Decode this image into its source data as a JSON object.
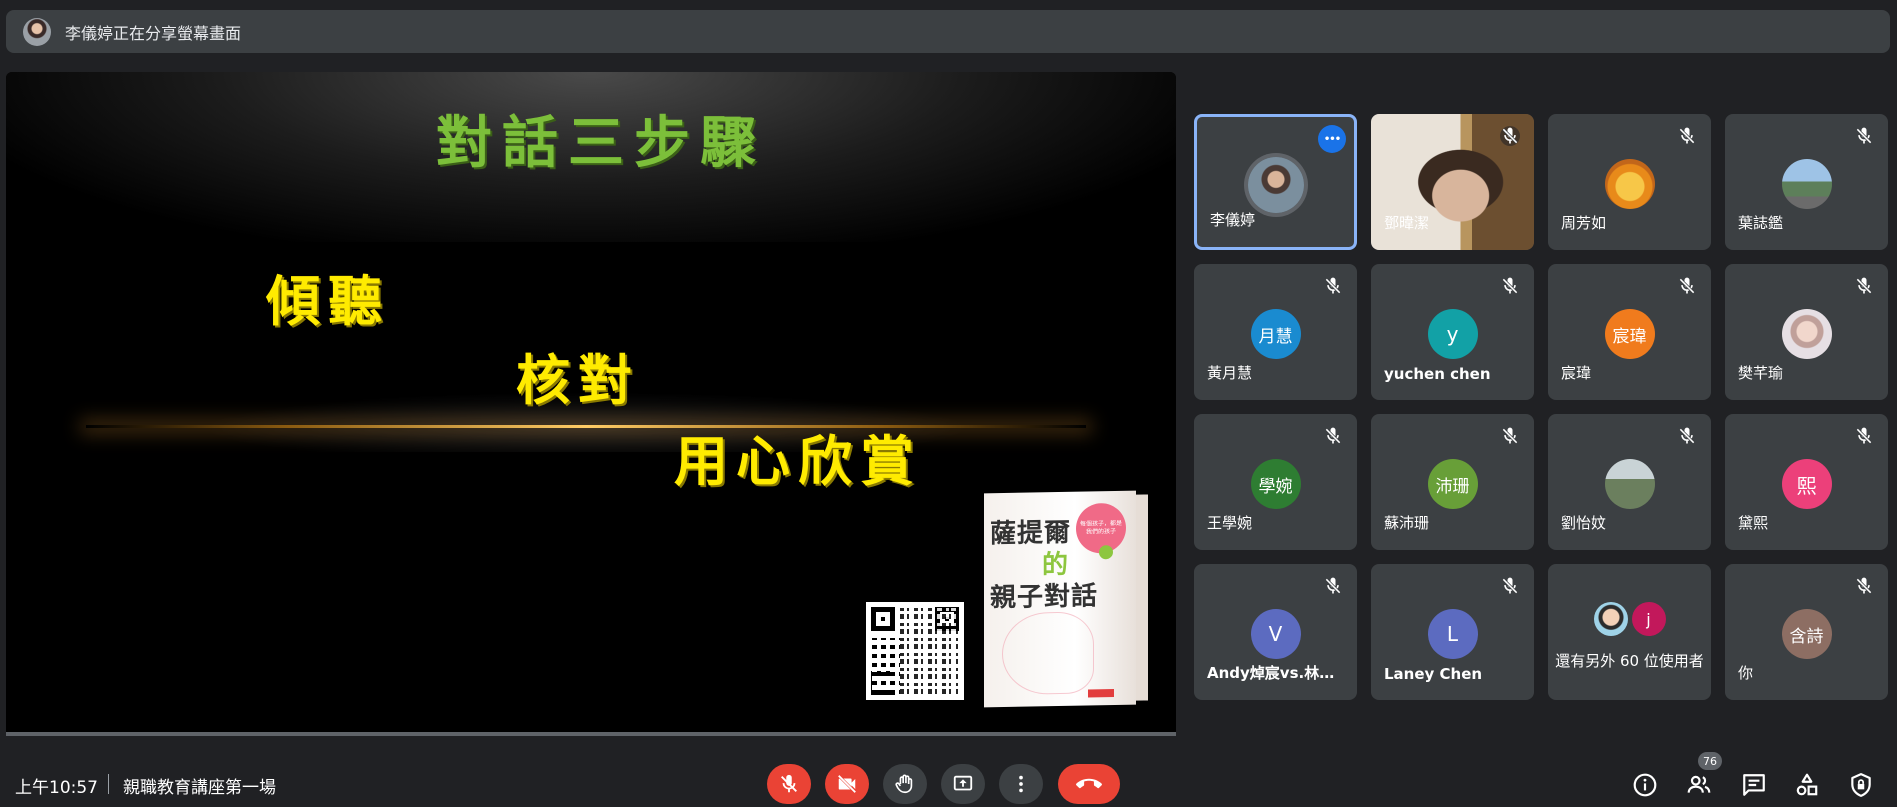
{
  "banner": {
    "text": "李儀婷正在分享螢幕畫面"
  },
  "slide": {
    "title": "對話三步驟",
    "steps": [
      "傾聽",
      "核對",
      "用心欣賞"
    ],
    "book": {
      "title_line1": "薩提爾",
      "title_line2": "的",
      "title_line3": "親子對話",
      "bubble": "每個孩子，都是我們的孩子"
    }
  },
  "participants": [
    {
      "name": "李儀婷",
      "avatar": "",
      "color": "",
      "type": "photo"
    },
    {
      "name": "鄧暐潔",
      "avatar": "",
      "color": "",
      "type": "video"
    },
    {
      "name": "周芳如",
      "avatar": "",
      "color": "",
      "type": "pooh"
    },
    {
      "name": "葉誌鑑",
      "avatar": "",
      "color": "",
      "type": "scene"
    },
    {
      "name": "黃月慧",
      "avatar": "月慧",
      "color": "#1a8bd0",
      "type": "initial"
    },
    {
      "name": "yuchen chen",
      "avatar": "y",
      "color": "#12a1a6",
      "type": "initial"
    },
    {
      "name": "宸瑋",
      "avatar": "宸瑋",
      "color": "#f07b1d",
      "type": "initial"
    },
    {
      "name": "樊芊瑜",
      "avatar": "",
      "color": "",
      "type": "girl"
    },
    {
      "name": "王學婉",
      "avatar": "學婉",
      "color": "#2e7d32",
      "type": "initial"
    },
    {
      "name": "蘇沛珊",
      "avatar": "沛珊",
      "color": "#689f38",
      "type": "initial"
    },
    {
      "name": "劉怡妏",
      "avatar": "",
      "color": "",
      "type": "mount"
    },
    {
      "name": "黛熙",
      "avatar": "熙",
      "color": "#ec407a",
      "type": "initial"
    },
    {
      "name": "Andy焯宸vs.林源...",
      "avatar": "V",
      "color": "#5c6bc0",
      "type": "initial"
    },
    {
      "name": "Laney Chen",
      "avatar": "L",
      "color": "#5c6bc0",
      "type": "initial"
    },
    {
      "name": "還有另外 60 位使用者",
      "avatar": "j",
      "color": "#c2185b",
      "type": "others"
    },
    {
      "name": "你",
      "avatar": "含詩",
      "color": "#8d6e63",
      "type": "initial"
    }
  ],
  "bottom": {
    "time": "上午10:57",
    "meeting": "親職教育講座第一場",
    "people_count": "76"
  },
  "colors": {
    "end_call": "#ea4335",
    "active_outline": "#8ab4f8",
    "more_button": "#1a73e8"
  }
}
